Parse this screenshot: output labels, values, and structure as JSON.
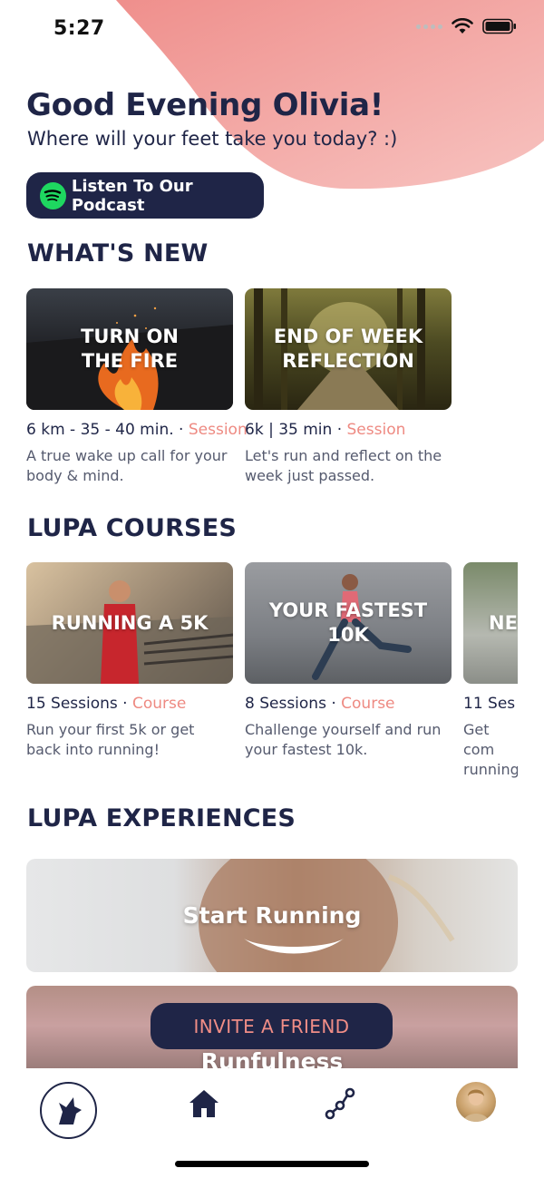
{
  "status_bar": {
    "time": "5:27"
  },
  "header": {
    "greeting": "Good Evening Olivia!",
    "subtitle": "Where will your feet take you today? :)",
    "podcast_button": "Listen To Our Podcast"
  },
  "whats_new": {
    "title": "WHAT'S NEW",
    "items": [
      {
        "image_title": "TURN ON\nTHE FIRE",
        "meta": "6 km - 35 - 40 min. · ",
        "tag": "Session",
        "description": "A true wake up call for your body & mind."
      },
      {
        "image_title": "END OF WEEK\nREFLECTION",
        "meta": "6k | 35 min · ",
        "tag": "Session",
        "description": "Let's run and reflect on the week just passed."
      }
    ]
  },
  "courses": {
    "title": "LUPA COURSES",
    "items": [
      {
        "image_title": "RUNNING A 5K",
        "meta": "15 Sessions · ",
        "tag": "Course",
        "description": "Run your first 5k or get back into running!"
      },
      {
        "image_title": "YOUR FASTEST\n10K",
        "meta": "8 Sessions · ",
        "tag": "Course",
        "description": "Challenge yourself and run your fastest 10k."
      },
      {
        "image_title": "NE",
        "meta": "11 Ses",
        "tag": "",
        "description": "Get com running"
      }
    ]
  },
  "experiences": {
    "title": "LUPA EXPERIENCES",
    "items": [
      {
        "title": "Start Running"
      },
      {
        "title": "Runfulness"
      }
    ]
  },
  "invite_button": "INVITE A FRIEND",
  "tab_bar": {
    "items": [
      "wolf-logo-icon",
      "home-icon",
      "network-icon",
      "profile-avatar"
    ]
  },
  "colors": {
    "navy": "#1f2547",
    "accent_pink": "#ee8a82",
    "blob_pink": "#f2a5a1"
  }
}
